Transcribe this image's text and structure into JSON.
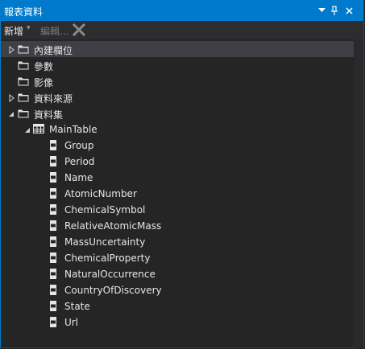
{
  "window": {
    "title": "報表資料"
  },
  "toolbar": {
    "new_label": "新增",
    "new_caret": "▾",
    "edit_label": "編輯..."
  },
  "tree": {
    "builtin_fields": "內建欄位",
    "parameters": "參數",
    "images": "影像",
    "data_sources": "資料來源",
    "datasets": "資料集",
    "table": "MainTable",
    "fields": [
      "Group",
      "Period",
      "Name",
      "AtomicNumber",
      "ChemicalSymbol",
      "RelativeAtomicMass",
      "MassUncertainty",
      "ChemicalProperty",
      "NaturalOccurrence",
      "CountryOfDiscovery",
      "State",
      "Url"
    ]
  },
  "colors": {
    "accent": "#007acc",
    "background": "#252526",
    "selection": "#3f3f46",
    "text": "#e6e6e6"
  },
  "icons": [
    "folder-icon",
    "table-icon",
    "field-icon",
    "triangle-collapsed-icon",
    "triangle-expanded-icon",
    "delete-icon",
    "pin-icon",
    "close-icon",
    "dropdown-icon"
  ]
}
